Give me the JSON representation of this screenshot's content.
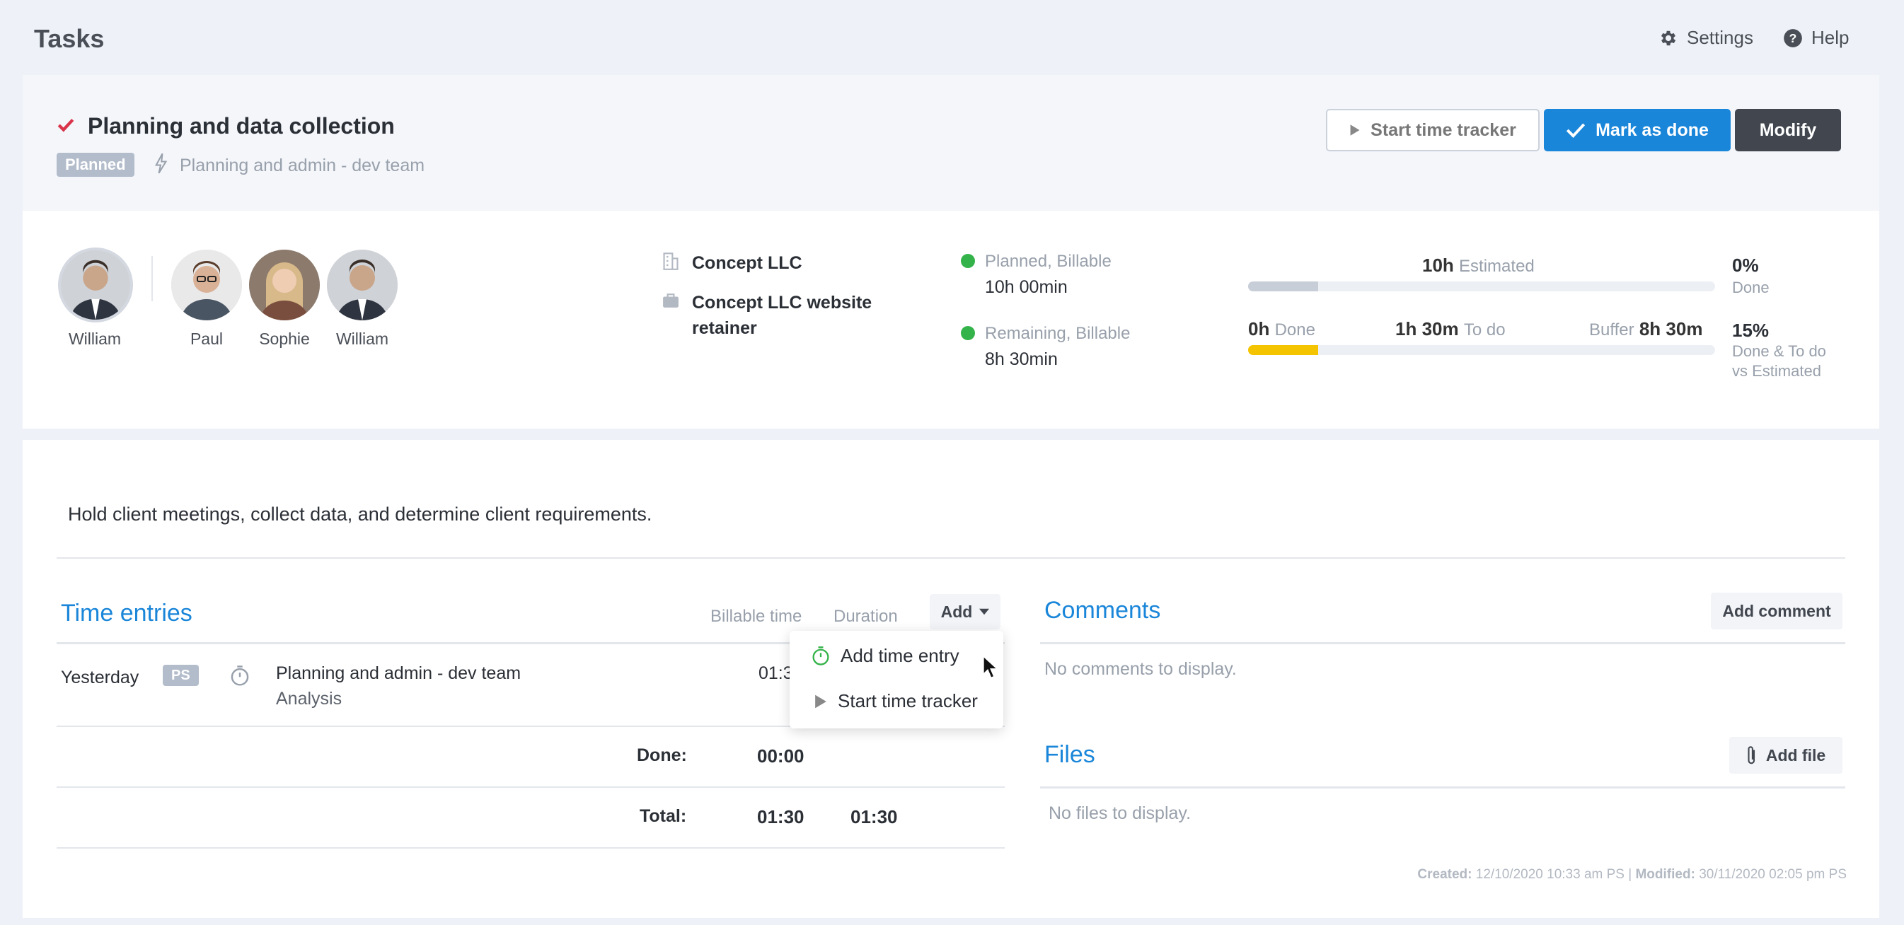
{
  "topbar": {
    "title": "Tasks",
    "settings_label": "Settings",
    "help_label": "Help"
  },
  "task": {
    "title": "Planning and data collection",
    "status": "Planned",
    "project": "Planning and admin - dev team",
    "colors": {
      "check": "#d9344a",
      "primary": "#1a86d9",
      "dark": "#41464f",
      "progress": "#f5c400"
    }
  },
  "actions": {
    "start_tracker": "Start time tracker",
    "mark_done": "Mark as done",
    "modify": "Modify"
  },
  "people": {
    "owner": "William",
    "assignees": [
      "Paul",
      "Sophie",
      "William"
    ]
  },
  "client": {
    "company": "Concept LLC",
    "project_line1": "Concept LLC website",
    "project_line2": "retainer"
  },
  "planned": {
    "label": "Planned, Billable",
    "value": "10h 00min"
  },
  "remaining": {
    "label": "Remaining, Billable",
    "value": "8h 30min"
  },
  "progress": {
    "estimated_value": "10h",
    "estimated_label": "Estimated",
    "estimated_fill": 0.15,
    "done_value": "0h",
    "done_label": "Done",
    "todo_value": "1h 30m",
    "todo_label": "To do",
    "buffer_label": "Buffer",
    "buffer_value": "8h 30m",
    "done_fill": 0.15,
    "pct_done": "0%",
    "pct_done_label": "Done",
    "pct_ratio": "15%",
    "pct_ratio_label1": "Done & To do",
    "pct_ratio_label2": "vs Estimated"
  },
  "description": "Hold client meetings, collect data, and determine client requirements.",
  "time_entries": {
    "title": "Time entries",
    "col_billable": "Billable time",
    "col_duration": "Duration",
    "add_label": "Add",
    "rows": [
      {
        "date": "Yesterday",
        "initials": "PS",
        "project": "Planning and admin - dev team",
        "activity": "Analysis",
        "billable": "01:30"
      }
    ],
    "done_label": "Done:",
    "done_value": "00:00",
    "total_label": "Total:",
    "total_billable": "01:30",
    "total_duration": "01:30"
  },
  "add_menu": {
    "add_time_entry": "Add time entry",
    "start_tracker": "Start time tracker"
  },
  "comments": {
    "title": "Comments",
    "add_label": "Add comment",
    "empty": "No comments to display."
  },
  "files": {
    "title": "Files",
    "add_label": "Add file",
    "empty": "No files to display."
  },
  "footer": {
    "created_label": "Created:",
    "created_value": "12/10/2020 10:33 am PS",
    "separator": "|",
    "modified_label": "Modified:",
    "modified_value": "30/11/2020 02:05 pm PS"
  }
}
